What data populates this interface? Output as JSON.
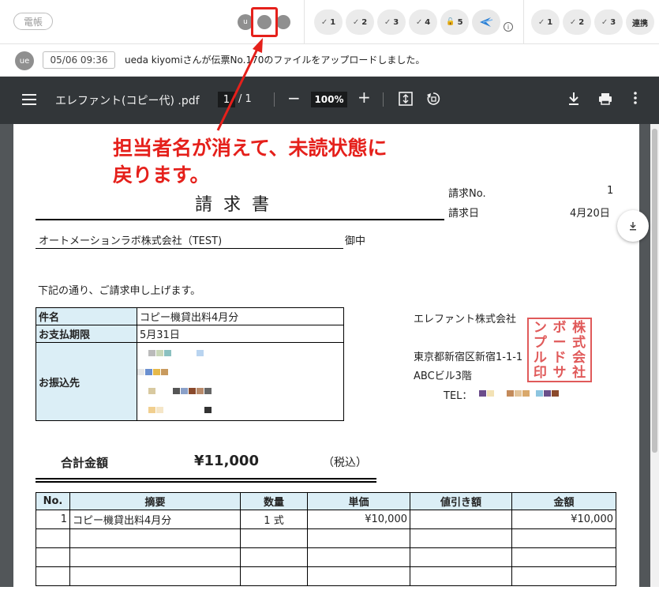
{
  "topbar": {
    "tag": "電帳",
    "avatar_u": "u",
    "steps_a": [
      {
        "num": "1",
        "check": "✓"
      },
      {
        "num": "2",
        "check": "✓"
      },
      {
        "num": "3",
        "check": "✓"
      },
      {
        "num": "4",
        "check": "✓"
      },
      {
        "num": "5",
        "check": "🔓"
      }
    ],
    "info": "i",
    "steps_b": [
      {
        "num": "1",
        "check": "✓"
      },
      {
        "num": "2",
        "check": "✓"
      },
      {
        "num": "3",
        "check": "✓"
      }
    ],
    "renkei": "連携"
  },
  "activity": {
    "avatar": "ue",
    "time": "05/06 09:36",
    "message": "ueda kiyomiさんが伝票No.170のファイルをアップロードしました。"
  },
  "viewer": {
    "title": "エレファント(コピー代) .pdf",
    "page": "1",
    "total": "/ 1",
    "zoom": "100%"
  },
  "callout": {
    "line1": "担当者名が消えて、未読状態に",
    "line2": "戻ります。"
  },
  "invoice": {
    "title": "請求書",
    "no_label": "請求No.",
    "no_value": "1",
    "date_label": "請求日",
    "date_value": "4月20日",
    "to_company": "オートメーションラボ株式会社（TEST)",
    "onchu": "御中",
    "intro": "下記の通り、ご請求申し上げます。",
    "fields": {
      "subject_label": "件名",
      "subject_value": "コピー機貸出料4月分",
      "due_label": "お支払期限",
      "due_value": "5月31日",
      "bank_label": "お振込先"
    },
    "sender": {
      "name": "エレファント株式会社",
      "address": "東京都新宿区新宿1-1-1",
      "building": "ABCビル3階",
      "tel_label": "TEL："
    },
    "seal_chars": [
      "株",
      "ボ",
      "ン",
      "式",
      "ー",
      "プ",
      "会",
      "ド",
      "ル",
      "社",
      "サ",
      "印"
    ],
    "total_label": "合計金額",
    "total_amount": "¥11,000",
    "total_tax": "（税込）",
    "headers": [
      "No.",
      "摘要",
      "数量",
      "単価",
      "値引き額",
      "金額"
    ],
    "rows": [
      [
        "1",
        "コピー機貸出料4月分",
        "1 式",
        "¥10,000",
        "",
        "¥10,000"
      ],
      [
        "",
        "",
        "",
        "",
        "",
        ""
      ],
      [
        "",
        "",
        "",
        "",
        "",
        ""
      ],
      [
        "",
        "",
        "",
        "",
        "",
        ""
      ]
    ]
  },
  "colors": {
    "accent_red": "#e5201b",
    "table_header": "#dbeef6",
    "toolbar": "#323639"
  }
}
